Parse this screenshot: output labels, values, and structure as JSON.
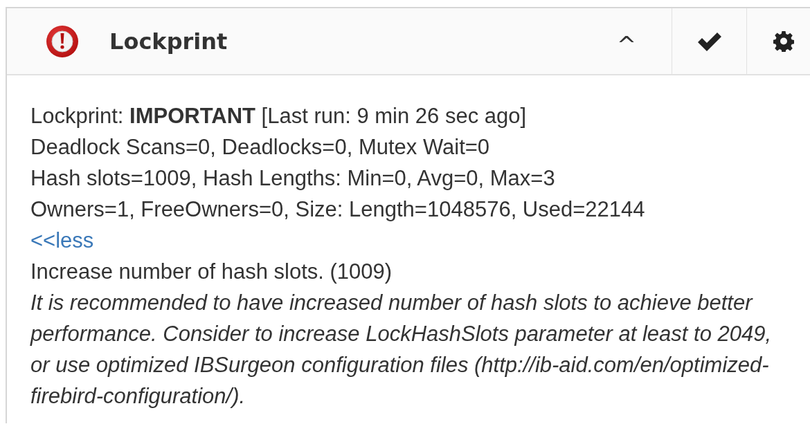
{
  "panel": {
    "title": "Lockprint",
    "collapse_icon": "^",
    "status_line": "Lockprint: **IMPORTANT** [Last run: 9 min 26 sec ago]",
    "details": [
      "Deadlock Scans=0, Deadlocks=0, Mutex Wait=0",
      "Hash slots=1009, Hash Lengths: Min=0, Avg=0, Max=3",
      "Owners=1, FreeOwners=0, Size: Length=1048576, Used=22144"
    ],
    "less_link": "<<less",
    "recommendation": "Increase number of hash slots. (1009)",
    "explanation": "It is recommended to have increased number of hash slots to achieve better performance. Consider to increase LockHashSlots parameter at least to 2049, or use optimized IBSurgeon configuration files (http://ib-aid.com/en/optimized-firebird-configuration/)."
  }
}
